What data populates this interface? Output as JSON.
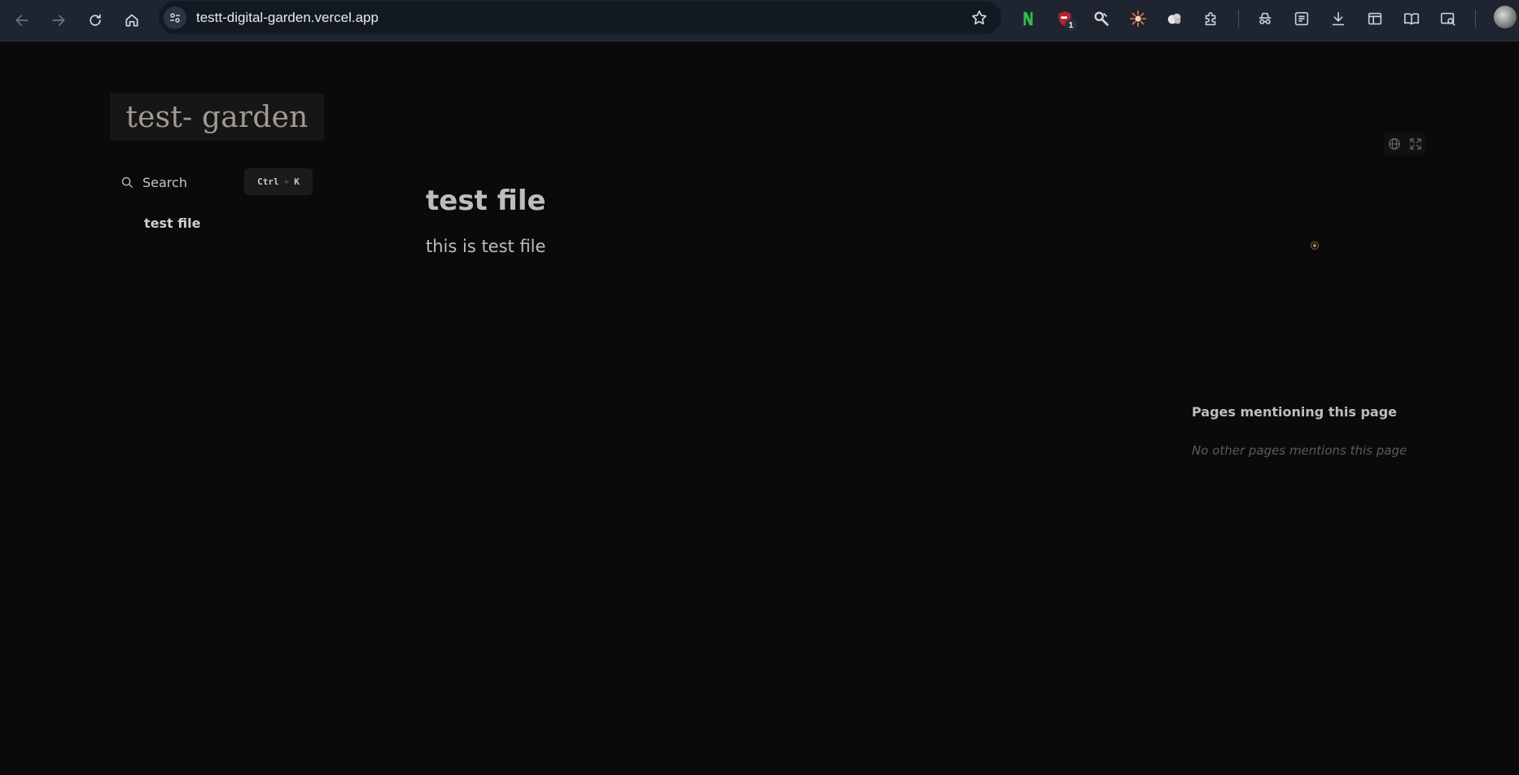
{
  "browser": {
    "url": "testt-digital-garden.vercel.app",
    "nav": {
      "back_icon": "arrow-left-icon",
      "forward_icon": "arrow-right-icon",
      "reload_icon": "reload-icon",
      "home_icon": "home-icon"
    },
    "extensions": [
      {
        "name": "extension-n",
        "icon": "n-letter-icon",
        "color": "#2fbf4a"
      },
      {
        "name": "extension-shield",
        "icon": "shield-icon",
        "color": "#d03a3a",
        "badge": "1"
      },
      {
        "name": "extension-tool",
        "icon": "tool-icon",
        "color": "#d8d8d8"
      },
      {
        "name": "extension-burst",
        "icon": "burst-icon",
        "color": "#e0664a"
      },
      {
        "name": "extension-cloud",
        "icon": "cloud-icon",
        "color": "#e6e6e6"
      },
      {
        "name": "extensions-menu",
        "icon": "puzzle-icon",
        "color": "#c9ced6"
      }
    ],
    "toolbar_icons": [
      "incognito-icon",
      "reading-list-icon",
      "download-icon",
      "sidebar-icon",
      "reader-icon",
      "search-tab-icon"
    ]
  },
  "sidebar": {
    "site_title": "test- garden",
    "search_label": "Search",
    "shortcut": {
      "ctrl": "Ctrl",
      "plus": "+",
      "key": "K"
    },
    "items": [
      {
        "label": "test file"
      }
    ]
  },
  "article": {
    "title": "test file",
    "body": "this is test file"
  },
  "backlinks": {
    "title": "Pages mentioning this page",
    "empty": "No other pages mentions this page"
  },
  "colors": {
    "page_bg": "#0a0a0a",
    "chrome_bg": "#1e2530",
    "text": "#bdbdbd",
    "muted": "#5a5a5a"
  }
}
